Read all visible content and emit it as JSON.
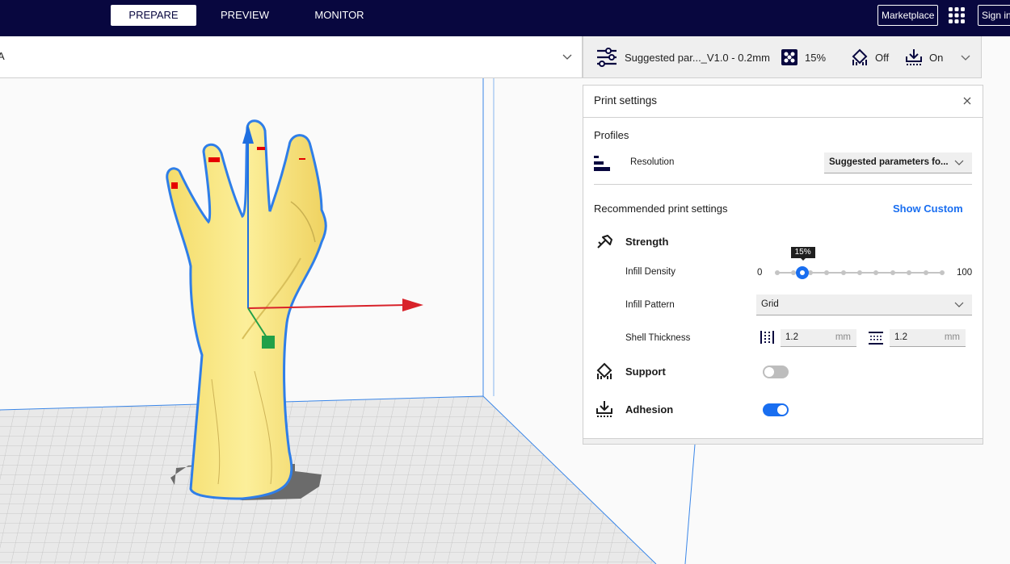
{
  "header": {
    "stages": [
      {
        "label": "PREPARE",
        "active": true
      },
      {
        "label": "PREVIEW",
        "active": false
      },
      {
        "label": "MONITOR",
        "active": false
      }
    ],
    "marketplace_label": "Marketplace",
    "signin_label": "Sign in",
    "apps_icon": "grid-icon"
  },
  "printer_selector": {
    "name": "A",
    "icon": "chevron-down-icon"
  },
  "settings_summary": {
    "profile": "Suggested par..._V1.0 - 0.2mm",
    "infill": "15%",
    "support": "Off",
    "adhesion": "On"
  },
  "print_settings": {
    "title": "Print settings",
    "profiles_label": "Profiles",
    "resolution_label": "Resolution",
    "resolution_value": "Suggested parameters fo...",
    "recommended_label": "Recommended print settings",
    "show_custom_label": "Show Custom",
    "strength_label": "Strength",
    "infill_density_label": "Infill Density",
    "infill_min": "0",
    "infill_max": "100",
    "infill_value": 15,
    "infill_tooltip": "15%",
    "infill_pattern_label": "Infill Pattern",
    "infill_pattern_value": "Grid",
    "shell_thickness_label": "Shell Thickness",
    "wall_thickness": "1.2",
    "top_bottom_thickness": "1.2",
    "unit": "mm",
    "support_label": "Support",
    "support_enabled": false,
    "adhesion_label": "Adhesion",
    "adhesion_enabled": true
  },
  "colors": {
    "header_bg": "#08073f",
    "accent": "#196ef0",
    "model": "#f9e782",
    "model_outline": "#2f7ee8",
    "axis_x": "#d8222a",
    "axis_y": "#1f6fe0",
    "axis_z": "#22a048"
  }
}
